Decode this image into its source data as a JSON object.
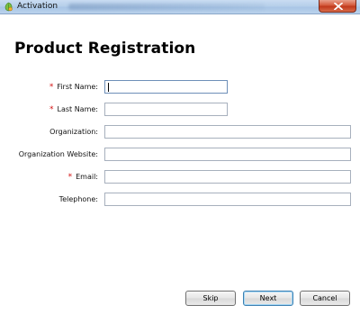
{
  "window": {
    "title": "Activation",
    "icon": "activation-app-icon",
    "close_icon": "close-icon"
  },
  "form": {
    "heading": "Product Registration",
    "fields": [
      {
        "label": "First Name:",
        "required": true,
        "value": ""
      },
      {
        "label": "Last Name:",
        "required": true,
        "value": ""
      },
      {
        "label": "Organization:",
        "required": false,
        "value": ""
      },
      {
        "label": "Organization Website:",
        "required": false,
        "value": ""
      },
      {
        "label": "Email:",
        "required": true,
        "value": ""
      },
      {
        "label": "Telephone:",
        "required": false,
        "value": ""
      }
    ],
    "required_marker": "*"
  },
  "buttons": {
    "skip": "Skip",
    "next": "Next",
    "cancel": "Cancel"
  }
}
